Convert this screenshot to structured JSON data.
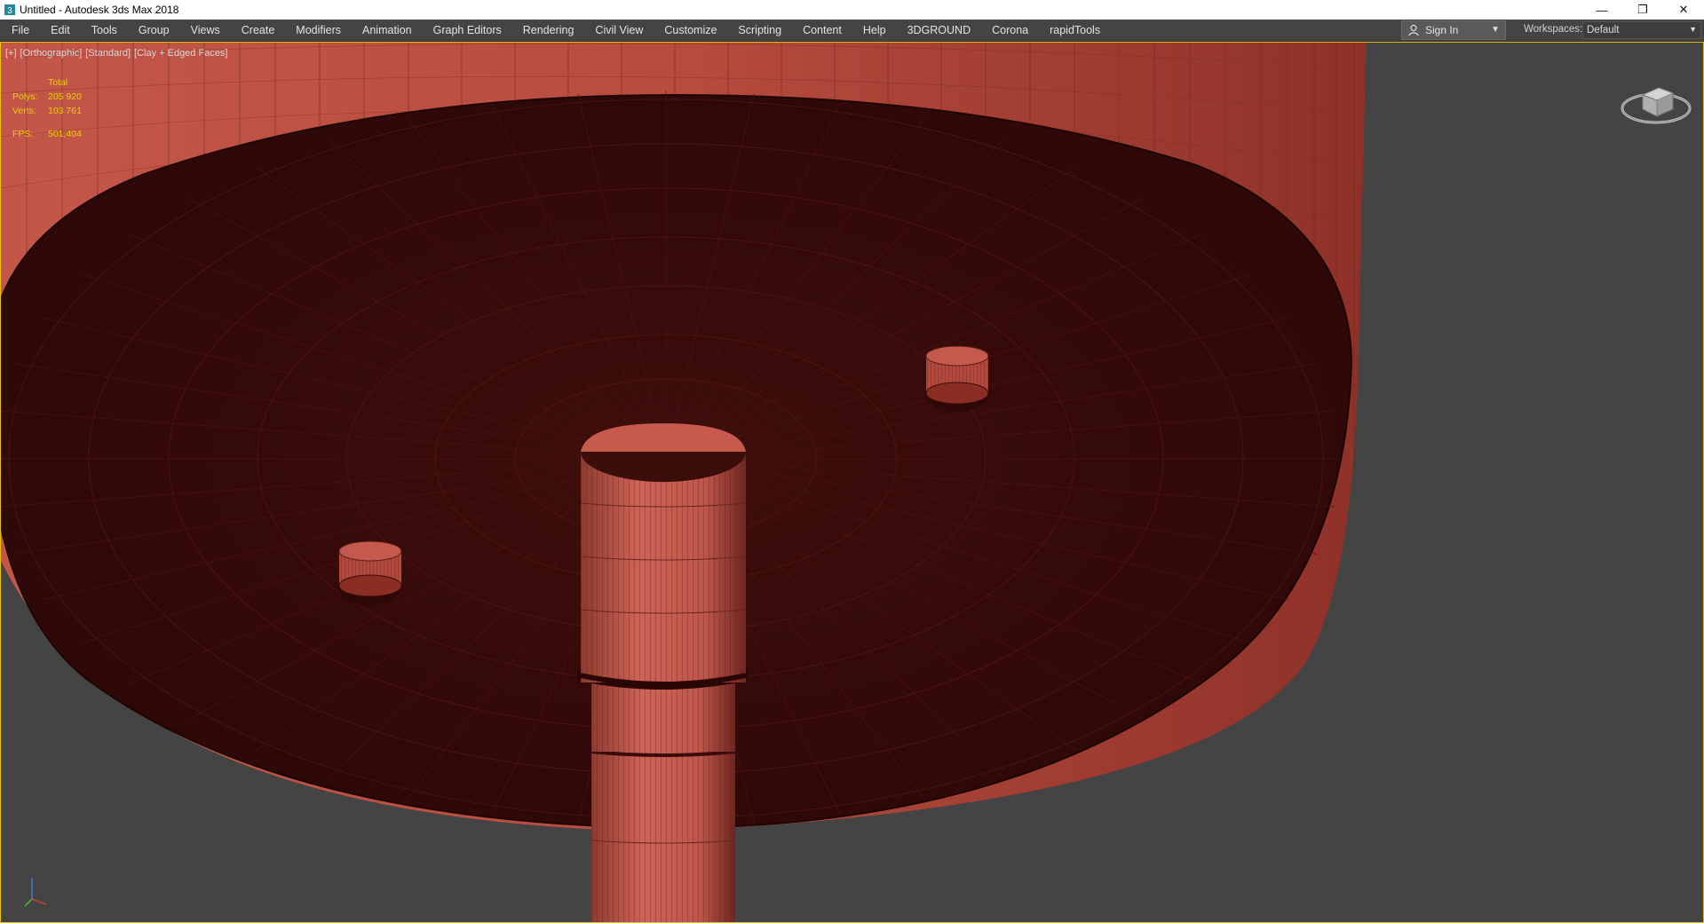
{
  "window": {
    "title": "Untitled - Autodesk 3ds Max 2018",
    "minimize_glyph": "—",
    "restore_glyph": "❐",
    "close_glyph": "✕"
  },
  "menu": {
    "items": [
      "File",
      "Edit",
      "Tools",
      "Group",
      "Views",
      "Create",
      "Modifiers",
      "Animation",
      "Graph Editors",
      "Rendering",
      "Civil View",
      "Customize",
      "Scripting",
      "Content",
      "Help",
      "3DGROUND",
      "Corona",
      "rapidTools"
    ]
  },
  "signin": {
    "label": "Sign In",
    "icon": "user-icon"
  },
  "workspaces": {
    "label": "Workspaces:",
    "value": "Default"
  },
  "viewport": {
    "labels": [
      "[+]",
      "[Orthographic]",
      "[Standard]",
      "[Clay + Edged Faces]"
    ],
    "stats": {
      "header": "Total",
      "polys_label": "Polys:",
      "polys_value": "205 920",
      "verts_label": "Verts:",
      "verts_value": "103 761",
      "fps_label": "FPS:",
      "fps_value": "501,404"
    }
  },
  "colors": {
    "ui_background": "#444444",
    "viewport_background": "#444444",
    "model_side": "#b34a3c",
    "model_bottom": "#3a0f0d",
    "stats_text": "#e8d000",
    "active_border": "#e8c000"
  },
  "icons": [
    "app-icon",
    "user-icon",
    "dropdown-arrow-icon",
    "viewcube-icon",
    "axis-gizmo-icon"
  ]
}
